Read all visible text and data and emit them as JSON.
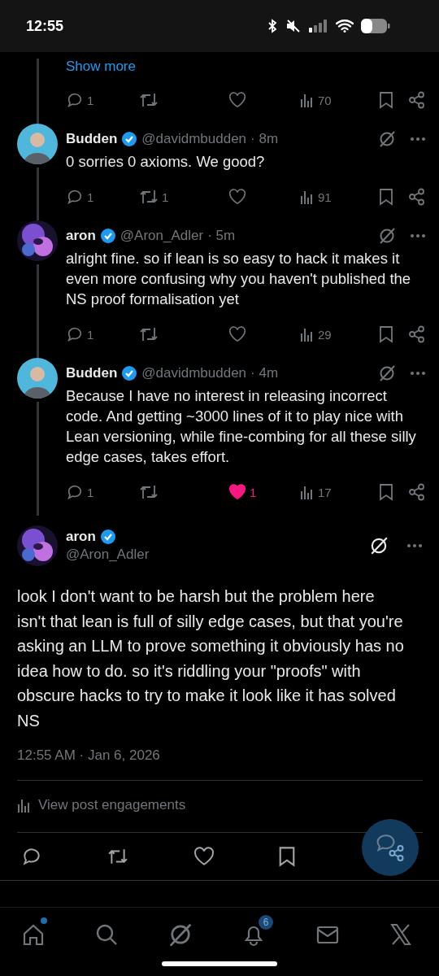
{
  "status_bar": {
    "time": "12:55"
  },
  "partial_reply": {
    "show_more": "Show more",
    "actions": {
      "replies": "1",
      "liked": false,
      "views": "70"
    }
  },
  "replies": [
    {
      "name": "Budden",
      "handle": "@davidmbudden",
      "time": "· 8m",
      "text": "0 sorries 0 axioms. We good?",
      "actions": {
        "replies": "1",
        "reposts": "1",
        "liked": false,
        "views": "91"
      }
    },
    {
      "name": "aron",
      "handle": "@Aron_Adler",
      "time": "· 5m",
      "text": "alright fine. so if lean is so easy to hack it makes it even more confusing why you haven't published the NS proof formalisation yet",
      "actions": {
        "replies": "1",
        "liked": false,
        "views": "29"
      }
    },
    {
      "name": "Budden",
      "handle": "@davidmbudden",
      "time": "· 4m",
      "text": "Because I have no interest in releasing incorrect code. And getting ~3000 lines of it to play nice with Lean versioning, while fine-combing for all these silly edge cases, takes effort.",
      "actions": {
        "replies": "1",
        "likes": "1",
        "liked": true,
        "views": "17"
      }
    }
  ],
  "main_post": {
    "name": "aron",
    "handle": "@Aron_Adler",
    "text": "look I don't want to be harsh but the problem here isn't that lean is full of silly edge cases, but that you're asking an LLM to prove something it obviously has no idea how to do. so it's riddling your \"proofs\" with obscure hacks to try to make it look like it has solved NS",
    "timestamp": "12:55 AM · Jan 6, 2026",
    "engagements": "View post engagements"
  },
  "bottom_nav": [
    {
      "kind": "home",
      "dot": true
    },
    {
      "kind": "search",
      "dot": false
    },
    {
      "kind": "grok",
      "dot": false
    },
    {
      "kind": "bell",
      "dot": false,
      "badge": "6"
    },
    {
      "kind": "mail",
      "dot": false
    },
    {
      "kind": "x",
      "dot": false
    }
  ]
}
